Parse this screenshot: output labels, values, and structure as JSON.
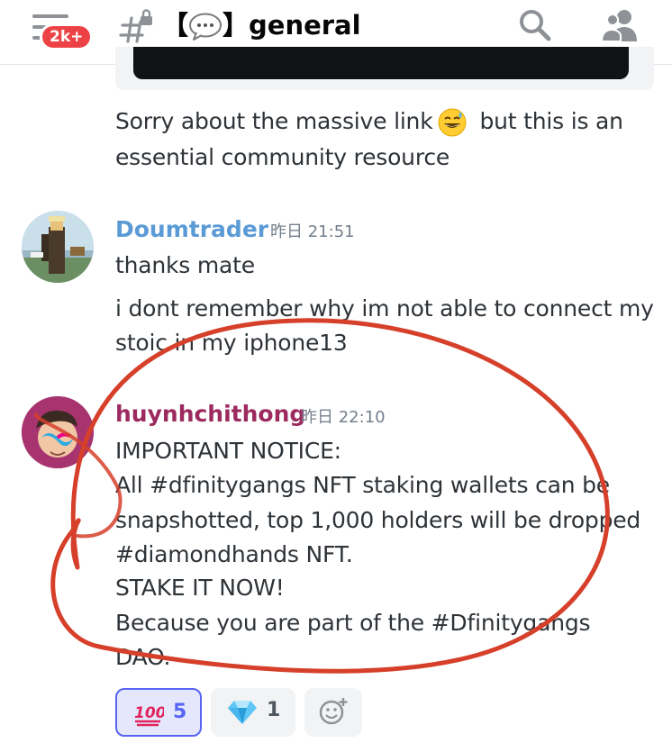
{
  "header": {
    "unread_badge": "2k+",
    "channel_prefix": "【",
    "channel_suffix": "】general"
  },
  "messages": [
    {
      "lines": [
        "Sorry about the massive link",
        "but this is an",
        "essential community resource"
      ]
    },
    {
      "author": "Doumtrader",
      "timestamp": "昨日 21:51",
      "author_color": "#5b9bd5",
      "lines": [
        "thanks mate"
      ]
    },
    {
      "lines": [
        "i dont remember why im not able to connect my",
        "stoic in my iphone13"
      ]
    },
    {
      "author": "huynhchithong",
      "timestamp": "昨日 22:10",
      "author_color": "#9c2a5f",
      "lines": [
        "IMPORTANT NOTICE:",
        "All #dfinitygangs NFT staking wallets can be",
        "snapshotted, top 1,000 holders will be dropped",
        "#diamondhands NFT.",
        "STAKE IT NOW!",
        "Because you are part of the #Dfinitygangs",
        "DAO."
      ]
    }
  ],
  "reactions": [
    {
      "icon": "hundred-points-icon",
      "count": "5",
      "active": true
    },
    {
      "icon": "gem-icon",
      "count": "1",
      "active": false
    },
    {
      "icon": "add-reaction-icon",
      "count": "",
      "active": false
    }
  ],
  "colors": {
    "accent": "#5865f2",
    "annotation": "#d6402b",
    "badge": "#ed4245"
  }
}
